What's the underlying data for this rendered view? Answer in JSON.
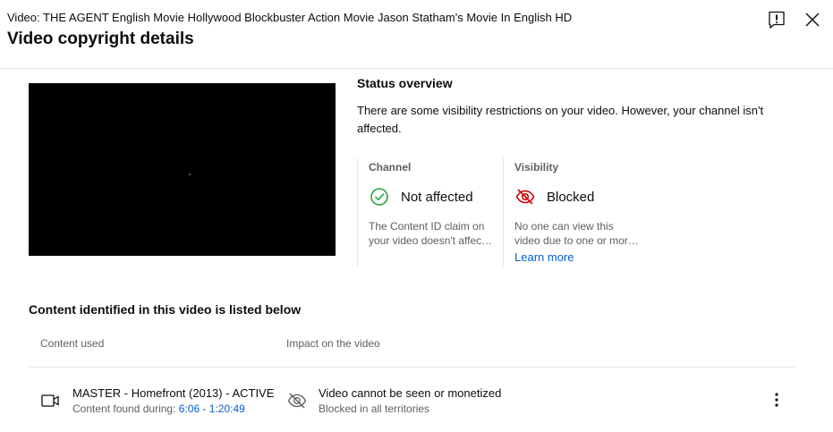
{
  "header": {
    "video_title": "Video: THE AGENT English Movie Hollywood Blockbuster Action Movie Jason Statham's Movie In English HD",
    "dialog_title": "Video copyright details",
    "feedback_icon": "feedback-icon",
    "close_icon": "close-icon"
  },
  "status": {
    "title": "Status overview",
    "description": "There are some visibility restrictions on your video. However, your channel isn't affected."
  },
  "cards": {
    "channel": {
      "label": "Channel",
      "status": "Not affected",
      "icon": "check-circle-icon",
      "icon_color": "#2ba640",
      "desc_line1": "The Content ID claim on",
      "desc_line2": "your video doesn't affect your channel"
    },
    "visibility": {
      "label": "Visibility",
      "status": "Blocked",
      "icon": "visibility-off-icon",
      "icon_color": "#cc0000",
      "desc_line1": "No one can view this",
      "desc_line2": "video due to one or more Content ID claims",
      "link": "Learn more"
    }
  },
  "content": {
    "heading": "Content identified in this video is listed below",
    "columns": {
      "content_used": "Content used",
      "impact": "Impact on the video"
    },
    "rows": [
      {
        "asset_name": "MASTER - Homefront (2013) - ACTIVE",
        "found_prefix": "Content found during: ",
        "time_range": "6:06 - 1:20:49",
        "impact_main": "Video cannot be seen or monetized",
        "impact_sub": "Blocked in all territories",
        "media_icon": "video-camera-icon",
        "impact_icon": "visibility-off-icon",
        "more_icon": "more-vert-icon"
      }
    ]
  },
  "colors": {
    "accent_link": "#065fd4",
    "secondary_text": "#606060",
    "divider": "#e5e5e5"
  }
}
